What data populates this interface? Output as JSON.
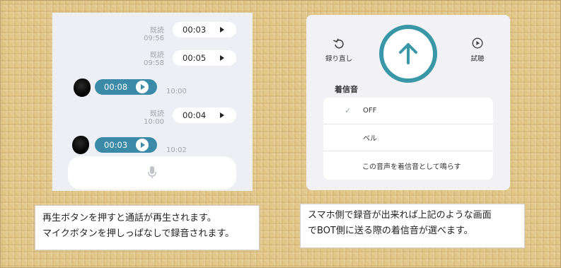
{
  "chat": {
    "messages": [
      {
        "direction": "out",
        "status": "既読",
        "time": "09:56",
        "duration": "00:03"
      },
      {
        "direction": "out",
        "status": "既読",
        "time": "09:58",
        "duration": "00:05"
      },
      {
        "direction": "in",
        "time": "10:00",
        "duration": "00:08"
      },
      {
        "direction": "out",
        "status": "既読",
        "time": "10:00",
        "duration": "00:04"
      },
      {
        "direction": "in",
        "time": "10:02",
        "duration": "00:03"
      }
    ],
    "composer_icon": "microphone-icon"
  },
  "recorder": {
    "redo_label": "録り直し",
    "trial_label": "試聴",
    "upload_icon": "arrow-up-icon",
    "ringtone_heading": "着信音",
    "options": [
      {
        "label": "OFF",
        "selected": true
      },
      {
        "label": "ベル",
        "selected": false
      },
      {
        "label": "この音声を着信音として鳴らす",
        "selected": false
      }
    ]
  },
  "captions": {
    "left": [
      "再生ボタンを押すと通話が再生されます。",
      "マイクボタンを押しっぱなしで録音されます。"
    ],
    "right": [
      "スマホ側で録音が出来れば上記のような画面",
      "でBOT側に送る際の着信音が選べます。"
    ]
  },
  "colors": {
    "accent": "#3a97a8",
    "bubble_in": "#3a8aa8",
    "background": "#e2c78a"
  }
}
